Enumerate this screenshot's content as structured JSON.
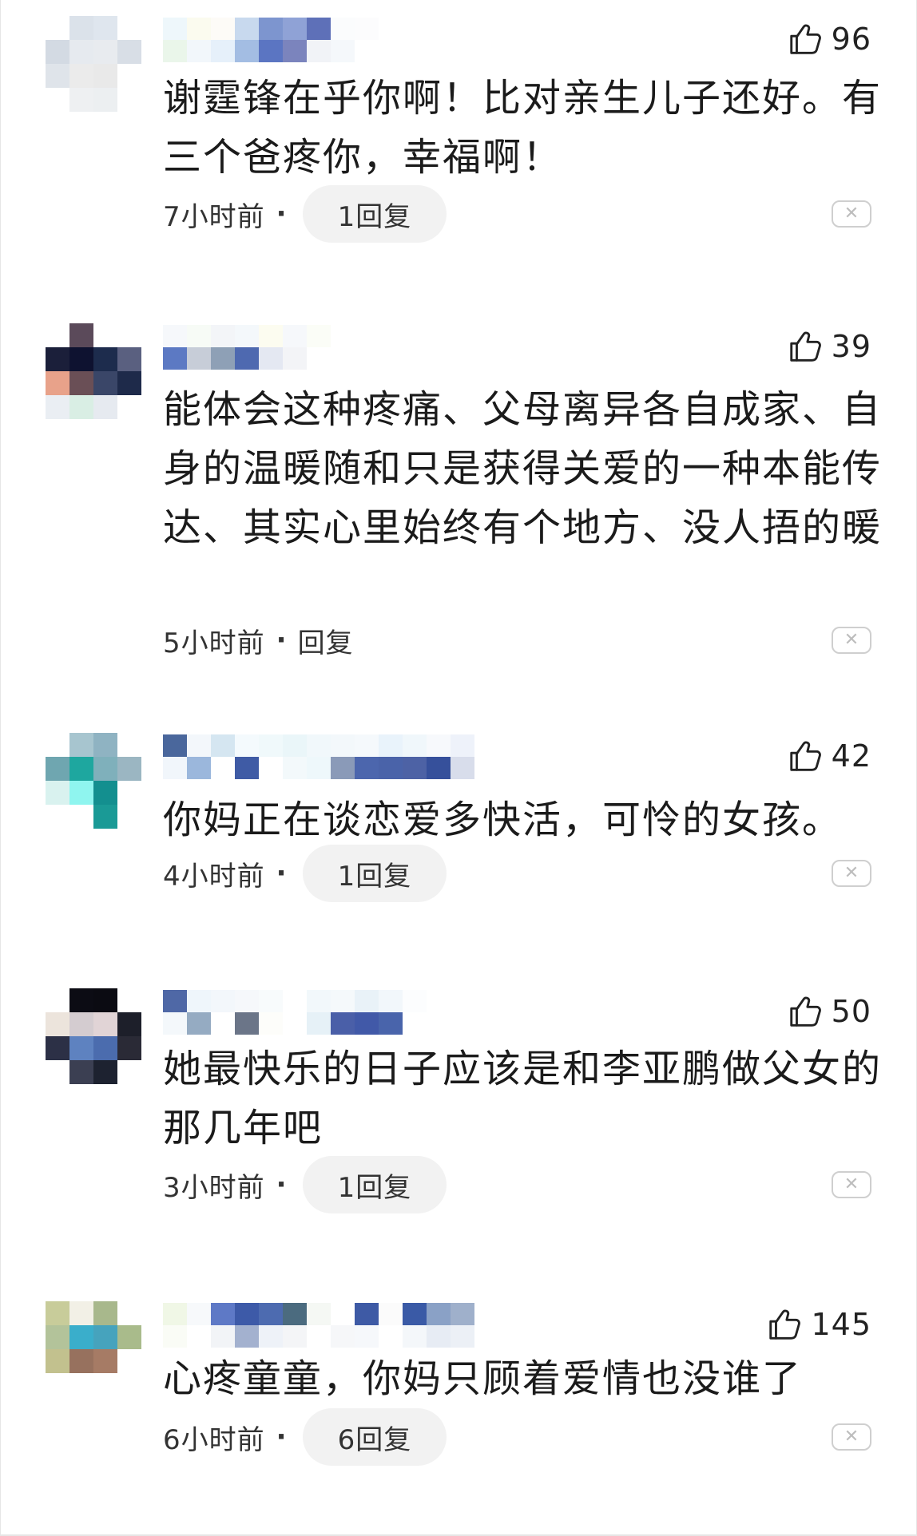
{
  "comments": [
    {
      "avatar_colors": [
        "#ffffff",
        "#dbe2ea",
        "#dfe6ee",
        "#ffffff",
        "#d3dae3",
        "#e6eaef",
        "#e8ebef",
        "#d8dee6",
        "#dfe4ea",
        "#ebebeb",
        "#e9e9e9",
        "#ffffff",
        "#ffffff",
        "#eef0f2",
        "#eceff1",
        "#ffffff"
      ],
      "username_colors": [
        "#eef7fb",
        "#eaf6ea",
        "#fbfbef",
        "#f2f7fb",
        "#fdfbf7",
        "#e6f0fa",
        "#c8d9ee",
        "#a3bde3",
        "#7d95cf",
        "#5b75c2",
        "#8fa2d6",
        "#7b84bd",
        "#5e70b8",
        "#f1f3f7",
        "#fbfcfd",
        "#f5f8fb",
        "#fcfcfd"
      ],
      "likes": "96",
      "text": "谢霆锋在乎你啊！比对亲生儿子还好。有三个爸疼你，幸福啊！",
      "time": "7小时前",
      "reply": "1回复",
      "reply_pill": true
    },
    {
      "avatar_colors": [
        "#ffffff",
        "#5b4a5a",
        "#ffffff",
        "#ffffff",
        "#1b1f3a",
        "#0e1230",
        "#1d2c4d",
        "#5a6080",
        "#e8a28a",
        "#6a4f56",
        "#3a4668",
        "#1e2a4a",
        "#eaeef3",
        "#d9eee4",
        "#e6eaf0",
        "#ffffff"
      ],
      "username_colors": [
        "#f6f8fb",
        "#5c79c3",
        "#f7fbf6",
        "#c7cdd8",
        "#f3f5f8",
        "#8ea0b6",
        "#f4f8fb",
        "#4e69b0",
        "#fcfcf0",
        "#e4e8f2",
        "#f6f8fb",
        "#f3f4f7",
        "#fbfdf7",
        "#ffffff"
      ],
      "likes": "39",
      "text": "能体会这种疼痛、父母离异各自成家、自身的温暖随和只是获得关爱的一种本能传达、其实心里始终有个地方、没人捂的暖",
      "time": "5小时前",
      "reply": "回复",
      "reply_pill": false
    },
    {
      "avatar_colors": [
        "#ffffff",
        "#a7c5cf",
        "#8fb3c2",
        "#ffffff",
        "#6fa6b0",
        "#1ea79f",
        "#7fb0bb",
        "#9bb6c2",
        "#d9f2ef",
        "#8ff5ef",
        "#138f8f",
        "#ffffff",
        "#ffffff",
        "#ffffff",
        "#1a9a96",
        "#ffffff"
      ],
      "username_colors": [
        "#4a679c",
        "#f1f6fb",
        "#f3f7fb",
        "#9bb7dc",
        "#d5e6f1",
        "#ffffff",
        "#f4fafd",
        "#3f5ba5",
        "#f0f9fb",
        "#ffffff",
        "#eaf6f9",
        "#f3f9fb",
        "#f1f8fb",
        "#eef8fb",
        "#f3f8fb",
        "#8a9ab8",
        "#f5f9fc",
        "#4c66ad",
        "#e9f3fb",
        "#4a63a9",
        "#f0f7fb",
        "#4d62a5",
        "#f7f9fc",
        "#36509b",
        "#eef2fa",
        "#d8ddeb"
      ],
      "likes": "42",
      "text": "你妈正在谈恋爱多快活，可怜的女孩。",
      "time": "4小时前",
      "reply": "1回复",
      "reply_pill": true
    },
    {
      "avatar_colors": [
        "#ffffff",
        "#0c0c14",
        "#0b0b12",
        "#ffffff",
        "#ece4dc",
        "#d4ccd0",
        "#e1d4d6",
        "#1d1f2a",
        "#2c3046",
        "#5e82c0",
        "#4b6cae",
        "#2a2a36",
        "#ffffff",
        "#3b3f52",
        "#1d2230",
        "#ffffff"
      ],
      "username_colors": [
        "#4f68a6",
        "#f4f8fb",
        "#eff6fb",
        "#95abc2",
        "#f3f7fb",
        "#ffffff",
        "#f6f8fb",
        "#6b7588",
        "#f8fbfc",
        "#fdfdfa",
        "#ffffff",
        "#ffffff",
        "#f2f8fb",
        "#e6f1f7",
        "#f5f9fb",
        "#4a5fa8",
        "#e9f2f8",
        "#4159a8",
        "#f2f7fb",
        "#4964ab",
        "#fcfdfe",
        "#ffffff"
      ],
      "likes": "50",
      "text": "她最快乐的日子应该是和李亚鹏做父女的那几年吧",
      "time": "3小时前",
      "reply": "1回复",
      "reply_pill": true
    },
    {
      "avatar_colors": [
        "#c8cc9a",
        "#f2f0e6",
        "#a8b88c",
        "#ffffff",
        "#b3c39a",
        "#3aaecb",
        "#46a3bd",
        "#a9bb8b",
        "#c2c18e",
        "#97715e",
        "#a67b65",
        "#ffffff",
        "#ffffff",
        "#ffffff",
        "#ffffff",
        "#ffffff"
      ],
      "username_colors": [
        "#f0f7e6",
        "#fafcf6",
        "#f7f9fb",
        "#ffffff",
        "#5e79c6",
        "#f2f4f7",
        "#3d5aa8",
        "#a3b1cf",
        "#4d6bb0",
        "#eef2f8",
        "#4b6b7f",
        "#f4f5f7",
        "#f5f8f4",
        "#ffffff",
        "#ffffff",
        "#f6f7f9",
        "#3e5aa5",
        "#f6f8fb",
        "#fbfbfb",
        "#ffffff",
        "#3a5aa6",
        "#f4f7fa",
        "#8aa1c6",
        "#e7ecf4",
        "#9fb0cb",
        "#ecf0f6"
      ],
      "likes": "145",
      "text": "心疼童童，你妈只顾着爱情也没谁了",
      "time": "6小时前",
      "reply": "6回复",
      "reply_pill": true
    }
  ],
  "icons": {
    "like": "thumbs-up-icon",
    "dismiss": "close-icon",
    "dismiss_glyph": "✕",
    "separator": "·"
  }
}
